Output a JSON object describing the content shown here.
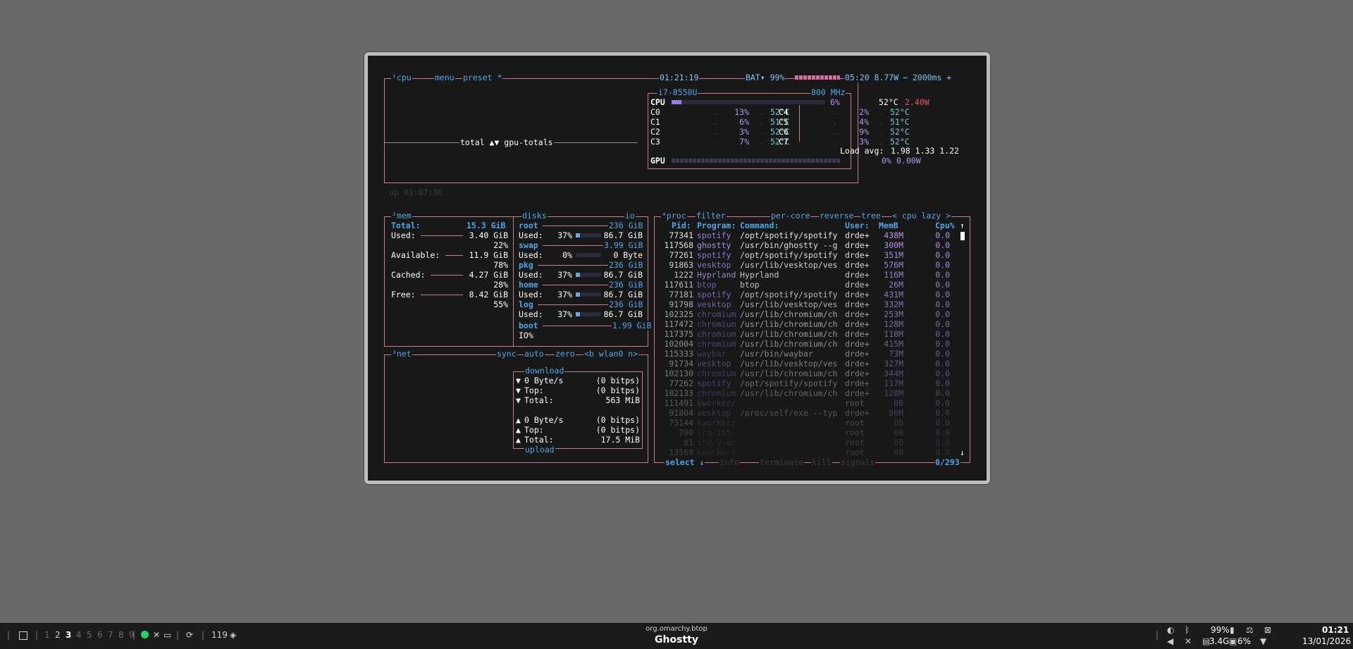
{
  "cpu": {
    "tabs": [
      "¹cpu",
      "menu",
      "preset *"
    ],
    "clock": "01:21:19",
    "battery": "BAT▾ 99%",
    "battery_time": "05:20 8.77W",
    "interval": "− 2000ms +",
    "model": "i7-8550U",
    "freq": "800 MHz",
    "total_label": "CPU",
    "total_pct": "6%",
    "total_temp": "52°C",
    "total_power": "2.40W",
    "cores": [
      {
        "name": "C0",
        "pct": "13%",
        "temp": "52°C"
      },
      {
        "name": "C1",
        "pct": "6%",
        "temp": "51°C"
      },
      {
        "name": "C2",
        "pct": "3%",
        "temp": "52°C"
      },
      {
        "name": "C3",
        "pct": "7%",
        "temp": "52°C"
      },
      {
        "name": "C4",
        "pct": "2%",
        "temp": "52°C"
      },
      {
        "name": "C5",
        "pct": "4%",
        "temp": "51°C"
      },
      {
        "name": "C6",
        "pct": "9%",
        "temp": "52°C"
      },
      {
        "name": "C7",
        "pct": "3%",
        "temp": "52°C"
      }
    ],
    "load_label": "Load avg:",
    "load_values": "1.98 1.33 1.22",
    "gpu_label": "GPU",
    "gpu_pct": "0%",
    "gpu_power": "0.00W",
    "graph_label": "total ▲▼ gpu-totals",
    "uptime": "up 01:07:36"
  },
  "mem": {
    "title": "²mem",
    "total_label": "Total:",
    "total_value": "15.3 GiB",
    "rows": [
      {
        "label": "Used:",
        "value": "3.40 GiB",
        "pct": "22%"
      },
      {
        "label": "Available:",
        "value": "11.9 GiB",
        "pct": "78%"
      },
      {
        "label": "Cached:",
        "value": "4.27 GiB",
        "pct": "28%"
      },
      {
        "label": "Free:",
        "value": "8.42 GiB",
        "pct": "55%"
      }
    ]
  },
  "disks": {
    "title": "disks",
    "io_tab": "io",
    "entries": [
      {
        "name": "root",
        "size": "236 GiB",
        "used_label": "Used:",
        "used_pct": "37%",
        "used_value": "86.7 GiB"
      },
      {
        "name": "swap",
        "size": "3.99 GiB",
        "used_label": "Used:",
        "used_pct": "0%",
        "used_value": "0 Byte"
      },
      {
        "name": "pkg",
        "size": "236 GiB",
        "used_label": "Used:",
        "used_pct": "37%",
        "used_value": "86.7 GiB"
      },
      {
        "name": "home",
        "size": "236 GiB",
        "used_label": "Used:",
        "used_pct": "37%",
        "used_value": "86.7 GiB"
      },
      {
        "name": "log",
        "size": "236 GiB",
        "used_label": "Used:",
        "used_pct": "37%",
        "used_value": "86.7 GiB"
      }
    ],
    "boot_name": "boot",
    "boot_size": "1.99 GiB",
    "boot_io": "IO%"
  },
  "net": {
    "title": "³net",
    "tabs": [
      "sync",
      "auto",
      "zero",
      "<b wlan0 n>"
    ],
    "download_title": "download",
    "upload_title": "upload",
    "down_rows": [
      {
        "arrow": "▼",
        "label": "0 Byte/s",
        "value": "(0 bitps)"
      },
      {
        "arrow": "▼",
        "label": "Top:",
        "value": "(0 bitps)"
      },
      {
        "arrow": "▼",
        "label": "Total:",
        "value": "563 MiB"
      }
    ],
    "up_rows": [
      {
        "arrow": "▲",
        "label": "0 Byte/s",
        "value": "(0 bitps)"
      },
      {
        "arrow": "▲",
        "label": "Top:",
        "value": "(0 bitps)"
      },
      {
        "arrow": "▲",
        "label": "Total:",
        "value": "17.5 MiB"
      }
    ]
  },
  "proc": {
    "tabs": [
      "⁴proc",
      "filter",
      "per-core",
      "reverse",
      "tree",
      "< cpu lazy >"
    ],
    "headers": {
      "pid": "Pid:",
      "program": "Program:",
      "command": "Command:",
      "user": "User:",
      "mem": "MemB",
      "cpu": "Cpu%"
    },
    "rows": [
      {
        "pid": "77341",
        "program": "spotify",
        "command": "/opt/spotify/spotify",
        "user": "drde+",
        "mem": "438M",
        "cpu": "0.0"
      },
      {
        "pid": "117568",
        "program": "ghostty",
        "command": "/usr/bin/ghostty --g",
        "user": "drde+",
        "mem": "300M",
        "cpu": "0.0"
      },
      {
        "pid": "77261",
        "program": "spotify",
        "command": "/opt/spotify/spotify",
        "user": "drde+",
        "mem": "351M",
        "cpu": "0.0"
      },
      {
        "pid": "91863",
        "program": "vesktop",
        "command": "/usr/lib/vesktop/ves",
        "user": "drde+",
        "mem": "576M",
        "cpu": "0.0"
      },
      {
        "pid": "1222",
        "program": "Hyprland",
        "command": "Hyprland",
        "user": "drde+",
        "mem": "116M",
        "cpu": "0.0"
      },
      {
        "pid": "117611",
        "program": "btop",
        "command": "btop",
        "user": "drde+",
        "mem": "26M",
        "cpu": "0.0"
      },
      {
        "pid": "77181",
        "program": "spotify",
        "command": "/opt/spotify/spotify",
        "user": "drde+",
        "mem": "431M",
        "cpu": "0.0"
      },
      {
        "pid": "91798",
        "program": "vesktop",
        "command": "/usr/lib/vesktop/ves",
        "user": "drde+",
        "mem": "332M",
        "cpu": "0.0"
      },
      {
        "pid": "102325",
        "program": "chromium",
        "command": "/usr/lib/chromium/ch",
        "user": "drde+",
        "mem": "253M",
        "cpu": "0.0"
      },
      {
        "pid": "117472",
        "program": "chromium",
        "command": "/usr/lib/chromium/ch",
        "user": "drde+",
        "mem": "128M",
        "cpu": "0.0"
      },
      {
        "pid": "117375",
        "program": "chromium",
        "command": "/usr/lib/chromium/ch",
        "user": "drde+",
        "mem": "118M",
        "cpu": "0.0"
      },
      {
        "pid": "102004",
        "program": "chromium",
        "command": "/usr/lib/chromium/ch",
        "user": "drde+",
        "mem": "415M",
        "cpu": "0.0"
      },
      {
        "pid": "115333",
        "program": "waybar",
        "command": "/usr/bin/waybar",
        "user": "drde+",
        "mem": "73M",
        "cpu": "0.0"
      },
      {
        "pid": "91734",
        "program": "vesktop",
        "command": "/usr/lib/vesktop/ves",
        "user": "drde+",
        "mem": "327M",
        "cpu": "0.0"
      },
      {
        "pid": "102130",
        "program": "chromium",
        "command": "/usr/lib/chromium/ch",
        "user": "drde+",
        "mem": "344M",
        "cpu": "0.0"
      },
      {
        "pid": "77262",
        "program": "spotify",
        "command": "/opt/spotify/spotify",
        "user": "drde+",
        "mem": "117M",
        "cpu": "0.0"
      },
      {
        "pid": "102133",
        "program": "chromium",
        "command": "/usr/lib/chromium/ch",
        "user": "drde+",
        "mem": "128M",
        "cpu": "0.0"
      },
      {
        "pid": "111491",
        "program": "kworker/",
        "command": "",
        "user": "root",
        "mem": "0B",
        "cpu": "0.0"
      },
      {
        "pid": "91804",
        "program": "vesktop",
        "command": "/proc/self/exe --typ",
        "user": "drde+",
        "mem": "90M",
        "cpu": "0.0"
      },
      {
        "pid": "73144",
        "program": "kworker/",
        "command": "",
        "user": "root",
        "mem": "0B",
        "cpu": "0.0"
      },
      {
        "pid": "790",
        "program": "irq/165-",
        "command": "",
        "user": "root",
        "mem": "0B",
        "cpu": "0.0"
      },
      {
        "pid": "81",
        "program": "irq/9-ac",
        "command": "",
        "user": "root",
        "mem": "0B",
        "cpu": "0.0"
      },
      {
        "pid": "13568",
        "program": "kworker/",
        "command": "",
        "user": "root",
        "mem": "0B",
        "cpu": "0.0"
      }
    ],
    "footer_select": "select ↓",
    "footer_info": "info",
    "footer_terminate": "terminate",
    "footer_kill": "kill",
    "footer_signals": "signals",
    "count": "0/293"
  },
  "taskbar": {
    "workspaces": [
      "1",
      "2",
      "3",
      "4",
      "5",
      "6",
      "7",
      "8",
      "9"
    ],
    "active_workspace": "3",
    "updates": "119",
    "window_class": "org.omarchy.btop",
    "window_title": "Ghostty",
    "battery": "99%",
    "memory": "3.4G",
    "cpu": "6%",
    "time": "01:21",
    "date": "13/01/2026"
  }
}
